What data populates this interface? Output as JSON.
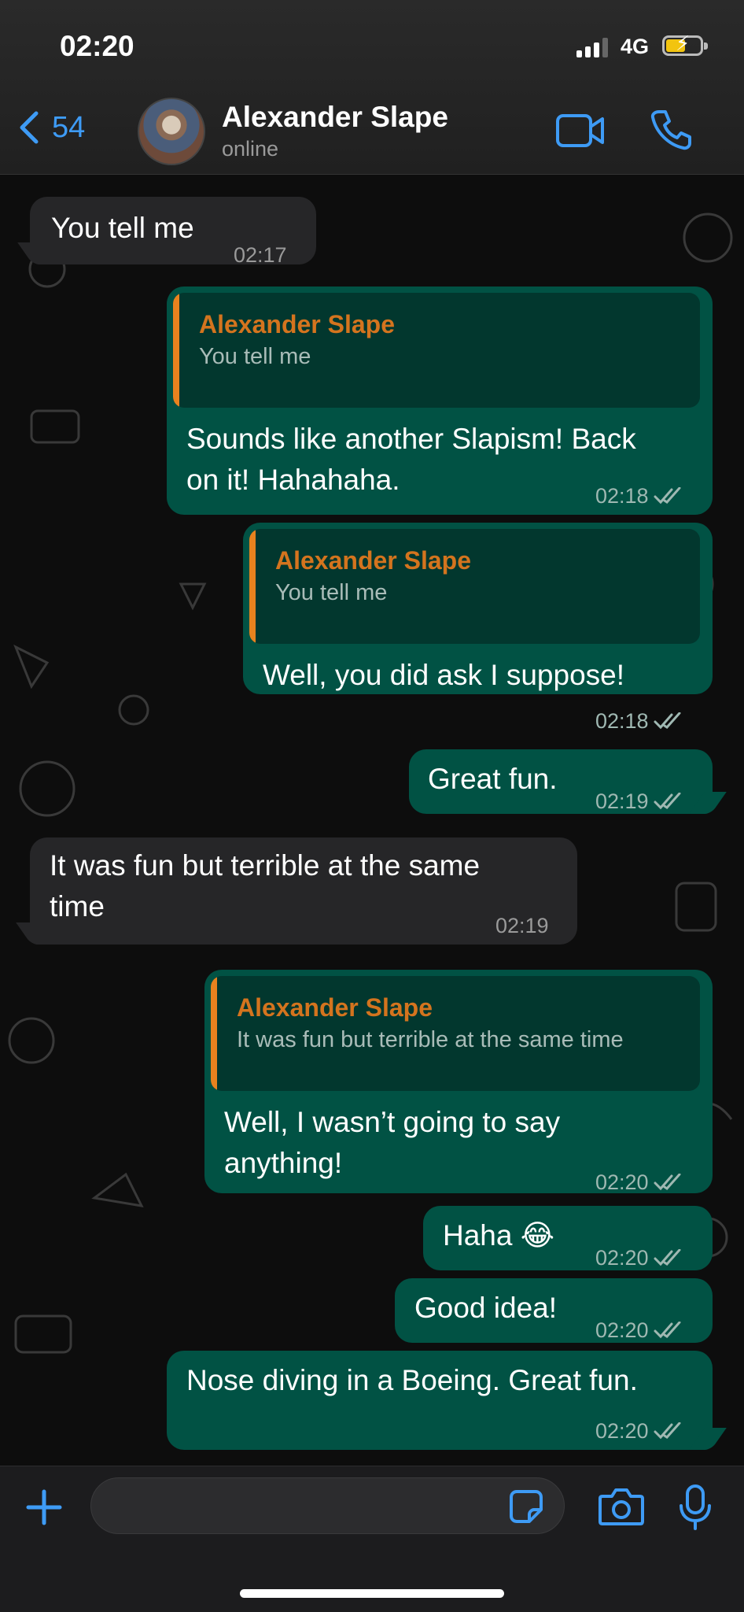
{
  "status": {
    "time": "02:20",
    "network": "4G"
  },
  "header": {
    "back_count": "54",
    "contact_name": "Alexander Slape",
    "contact_status": "online"
  },
  "messages": {
    "m0": {
      "text": "You tell me",
      "time": "02:17"
    },
    "m1": {
      "quote_name": "Alexander Slape",
      "quote_text": "You tell me",
      "line1": "Sounds like another Slapism! Back",
      "line2": "on it! Hahahaha.",
      "time": "02:18"
    },
    "m2": {
      "quote_name": "Alexander Slape",
      "quote_text": "You tell me",
      "text": "Well, you did ask I suppose!",
      "time": "02:18"
    },
    "m3": {
      "text": "Great fun.",
      "time": "02:19"
    },
    "m4": {
      "line1": "It was fun but terrible at the same",
      "line2": "time",
      "time": "02:19"
    },
    "m5": {
      "quote_name": "Alexander Slape",
      "quote_text": "It was fun but terrible at the same time",
      "line1": "Well, I wasn’t going to say",
      "line2": "anything!",
      "time": "02:20"
    },
    "m6": {
      "text": "Haha 😂",
      "time": "02:20"
    },
    "m7": {
      "text": "Good idea!",
      "time": "02:20"
    },
    "m8": {
      "text": "Nose diving in a Boeing. Great fun.",
      "time": "02:20"
    }
  },
  "colors": {
    "accent": "#3e9bf5",
    "outgoing_bubble": "#015244",
    "incoming_bubble": "#262628",
    "quote_name": "#d4741e"
  },
  "icons": [
    "chevron-left-icon",
    "video-call-icon",
    "phone-icon",
    "plus-icon",
    "sticker-icon",
    "camera-icon",
    "microphone-icon",
    "double-check-icon"
  ]
}
